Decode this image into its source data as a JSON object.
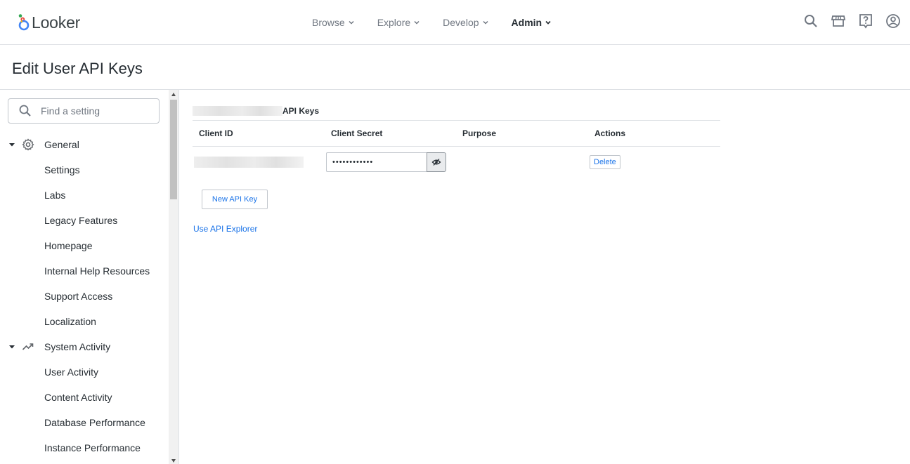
{
  "app": {
    "name": "Looker"
  },
  "nav": {
    "items": [
      {
        "label": "Browse",
        "active": false
      },
      {
        "label": "Explore",
        "active": false
      },
      {
        "label": "Develop",
        "active": false
      },
      {
        "label": "Admin",
        "active": true
      }
    ],
    "icons": [
      "search-icon",
      "marketplace-icon",
      "help-icon",
      "account-icon"
    ]
  },
  "page": {
    "title": "Edit User API Keys"
  },
  "sidebar": {
    "search_placeholder": "Find a setting",
    "sections": [
      {
        "label": "General",
        "icon": "gear-icon",
        "items": [
          "Settings",
          "Labs",
          "Legacy Features",
          "Homepage",
          "Internal Help Resources",
          "Support Access",
          "Localization"
        ]
      },
      {
        "label": "System Activity",
        "icon": "trending-up-icon",
        "items": [
          "User Activity",
          "Content Activity",
          "Database Performance",
          "Instance Performance"
        ]
      }
    ]
  },
  "api_keys": {
    "section_title": "API Keys",
    "columns": [
      "Client ID",
      "Client Secret",
      "Purpose",
      "Actions"
    ],
    "rows": [
      {
        "client_secret": "••••••••••••",
        "purpose": "",
        "action": "Delete"
      }
    ],
    "new_key_label": "New API Key",
    "explorer_link": "Use API Explorer"
  },
  "colors": {
    "accent": "#1a73e8",
    "text": "#262d33",
    "muted": "#707781",
    "border": "#dee1e5"
  }
}
